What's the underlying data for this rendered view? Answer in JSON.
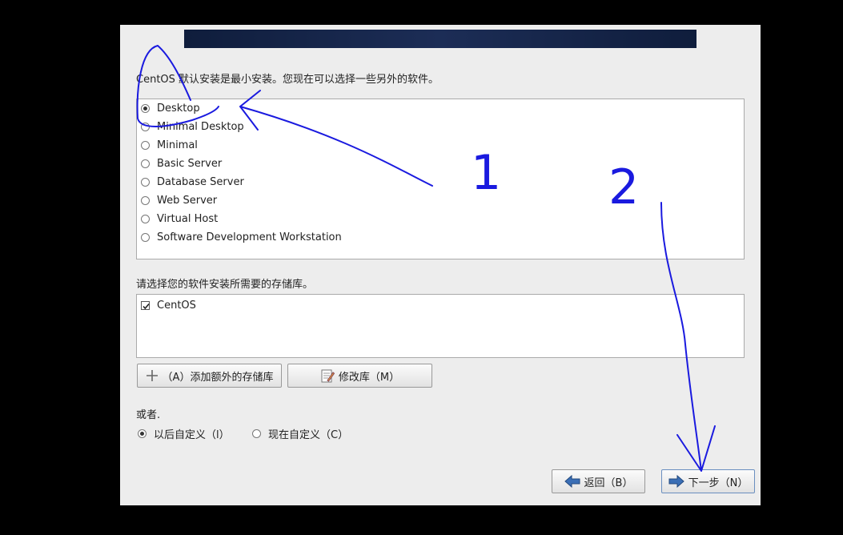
{
  "installer": {
    "intro_text": "CentOS 默认安装是最小安装。您现在可以选择一些另外的软件。",
    "environments": [
      {
        "label": "Desktop",
        "selected": true
      },
      {
        "label": "Minimal Desktop",
        "selected": false
      },
      {
        "label": "Minimal",
        "selected": false
      },
      {
        "label": "Basic Server",
        "selected": false
      },
      {
        "label": "Database Server",
        "selected": false
      },
      {
        "label": "Web Server",
        "selected": false
      },
      {
        "label": "Virtual Host",
        "selected": false
      },
      {
        "label": "Software Development Workstation",
        "selected": false
      }
    ],
    "repo_label": "请选择您的软件安装所需要的存储库。",
    "repos": [
      {
        "label": "CentOS",
        "checked": true
      }
    ],
    "add_repo_button": "（A）添加额外的存储库",
    "modify_repo_button": "修改库（M）",
    "or_label": "或者.",
    "customize_later": "以后自定义（l）",
    "customize_now": "现在自定义（C）",
    "back_button": "返回（B）",
    "next_button": "下一步（N）"
  },
  "annotations": {
    "step_one": "1",
    "step_two": "2",
    "ink_color": "#1a1adf"
  }
}
